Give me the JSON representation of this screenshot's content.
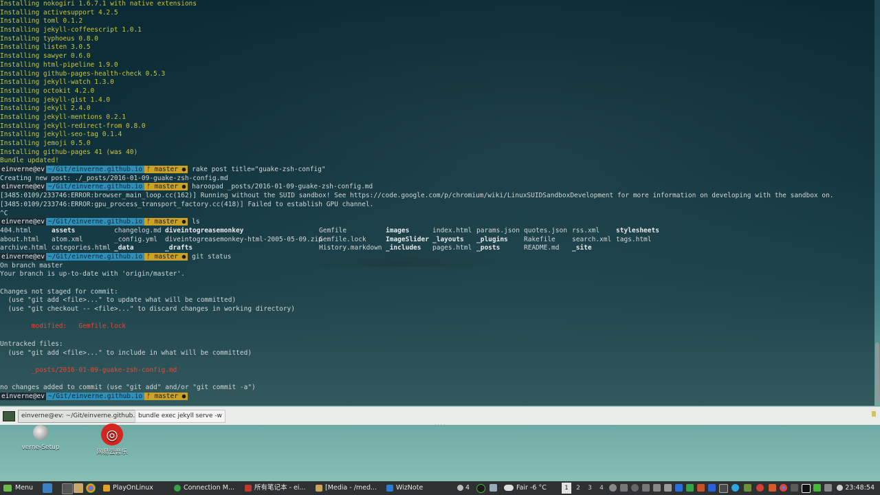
{
  "terminal": {
    "install_lines": [
      "Installing nokogiri 1.6.7.1 with native extensions",
      "Installing activesupport 4.2.5",
      "Installing toml 0.1.2",
      "Installing jekyll-coffeescript 1.0.1",
      "Installing typhoeus 0.8.0",
      "Installing listen 3.0.5",
      "Installing sawyer 0.6.0",
      "Installing html-pipeline 1.9.0",
      "Installing github-pages-health-check 0.5.3",
      "Installing jekyll-watch 1.3.0",
      "Installing octokit 4.2.0",
      "Installing jekyll-gist 1.4.0",
      "Installing jekyll 2.4.0",
      "Installing jekyll-mentions 0.2.1",
      "Installing jekyll-redirect-from 0.8.0",
      "Installing jekyll-seo-tag 0.1.4",
      "Installing jemoji 0.5.0",
      "Installing github-pages 41 (was 40)",
      "Bundle updated!"
    ],
    "prompt": {
      "user": "einverne@ev",
      "path": "~/Git/einverne.github.io",
      "branch": "ᚠ master ●"
    },
    "cmd1": "rake post title=\"guake-zsh-config\"",
    "cmd1_output": "Creating new post: ./_posts/2016-01-09-guake-zsh-config.md",
    "cmd2": "haroopad _posts/2016-01-09-guake-zsh-config.md",
    "cmd2_output_1": "[3485:0109/233746:ERROR:browser_main_loop.cc(162)] Running without the SUID sandbox! See https://code.google.com/p/chromium/wiki/LinuxSUIDSandboxDevelopment for more information on developing with the sandbox on.",
    "cmd2_output_2": "[3485:0109/233746:ERROR:gpu_process_transport_factory.cc(418)] Failed to establish GPU channel.",
    "interrupt": "^C",
    "cmd3": "ls",
    "ls_rows": [
      [
        {
          "t": "404.html",
          "b": false
        },
        {
          "t": "assets",
          "b": true
        },
        {
          "t": "changelog.md",
          "b": false
        },
        {
          "t": "diveintogreasemonkey",
          "b": true
        },
        {
          "t": "Gemfile",
          "b": false
        },
        {
          "t": "images",
          "b": true
        },
        {
          "t": "index.html",
          "b": false
        },
        {
          "t": "params.json",
          "b": false
        },
        {
          "t": "quotes.json",
          "b": false
        },
        {
          "t": "rss.xml",
          "b": false
        },
        {
          "t": "stylesheets",
          "b": true
        }
      ],
      [
        {
          "t": "about.html",
          "b": false
        },
        {
          "t": "atom.xml",
          "b": false
        },
        {
          "t": "_config.yml",
          "b": false
        },
        {
          "t": "diveintogreasemonkey-html-2005-05-09.zip",
          "b": false
        },
        {
          "t": "Gemfile.lock",
          "b": false
        },
        {
          "t": "ImageSlider",
          "b": true
        },
        {
          "t": "_layouts",
          "b": true
        },
        {
          "t": "_plugins",
          "b": true
        },
        {
          "t": "Rakefile",
          "b": false
        },
        {
          "t": "search.xml",
          "b": false
        },
        {
          "t": "tags.html",
          "b": false
        }
      ],
      [
        {
          "t": "archive.html",
          "b": false
        },
        {
          "t": "categories.html",
          "b": false
        },
        {
          "t": "_data",
          "b": true
        },
        {
          "t": "_drafts",
          "b": true
        },
        {
          "t": "History.markdown",
          "b": false
        },
        {
          "t": "_includes",
          "b": true
        },
        {
          "t": "pages.html",
          "b": false
        },
        {
          "t": "_posts",
          "b": true
        },
        {
          "t": "README.md",
          "b": false
        },
        {
          "t": "_site",
          "b": true
        },
        {
          "t": "",
          "b": false
        }
      ]
    ],
    "cmd4": "git status",
    "status_lines": [
      {
        "t": "On branch master",
        "c": ""
      },
      {
        "t": "Your branch is up-to-date with 'origin/master'.",
        "c": ""
      },
      {
        "t": "",
        "c": ""
      },
      {
        "t": "Changes not staged for commit:",
        "c": ""
      },
      {
        "t": "  (use \"git add <file>...\" to update what will be committed)",
        "c": ""
      },
      {
        "t": "  (use \"git checkout -- <file>...\" to discard changes in working directory)",
        "c": ""
      },
      {
        "t": "",
        "c": ""
      },
      {
        "t": "        modified:   Gemfile.lock",
        "c": "red"
      },
      {
        "t": "",
        "c": ""
      },
      {
        "t": "Untracked files:",
        "c": ""
      },
      {
        "t": "  (use \"git add <file>...\" to include in what will be committed)",
        "c": ""
      },
      {
        "t": "",
        "c": ""
      },
      {
        "t": "        _posts/2016-01-09-guake-zsh-config.md",
        "c": "red"
      },
      {
        "t": "",
        "c": ""
      },
      {
        "t": "no changes added to commit (use \"git add\" and/or \"git commit -a\")",
        "c": ""
      }
    ]
  },
  "guake": {
    "tabs": [
      "einverne@ev: ~/Git/einverne.github.io",
      "bundle exec jekyll serve -w"
    ]
  },
  "desktop": {
    "icons": [
      {
        "label": "verne-Setup",
        "icon": "disc-icon"
      },
      {
        "label": "网易云音乐",
        "icon": "netease-music-icon"
      }
    ]
  },
  "panel": {
    "menu_label": "Menu",
    "tasks": [
      {
        "label": "PlayOnLinux",
        "color": "#e0a12a"
      },
      {
        "label": "Connection M...",
        "color": "#3aa04a"
      },
      {
        "label": "所有笔记本 - ei...",
        "color": "#c0392b"
      },
      {
        "label": "[Media - /med...",
        "color": "#c9a45a"
      },
      {
        "label": "WizNote",
        "color": "#2a7bd4"
      }
    ],
    "cpu": "4",
    "weather": "Fair -6 °C",
    "workspaces": [
      "1",
      "2",
      "3",
      "4"
    ],
    "active_workspace": "1",
    "clock": "23:48:54"
  }
}
